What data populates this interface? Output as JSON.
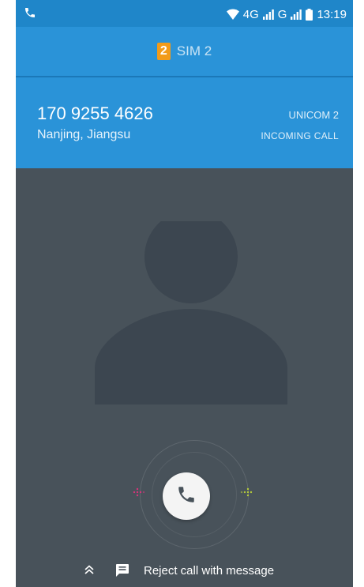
{
  "status_bar": {
    "network_label": "4G",
    "network2_label": "G",
    "time": "13:19"
  },
  "sim": {
    "badge": "2",
    "label": "SIM 2"
  },
  "caller": {
    "number": "170 9255 4626",
    "location": "Nanjing, Jiangsu",
    "carrier": "UNICOM 2",
    "state": "INCOMING CALL"
  },
  "actions": {
    "reject_with_message": "Reject call with message"
  },
  "colors": {
    "header_blue": "#2a93d8",
    "status_blue": "#1f86c9",
    "background": "#48525a",
    "sim_badge": "#f29b1a",
    "decline_hint": "#d6357a",
    "answer_hint": "#b6cc3a"
  }
}
